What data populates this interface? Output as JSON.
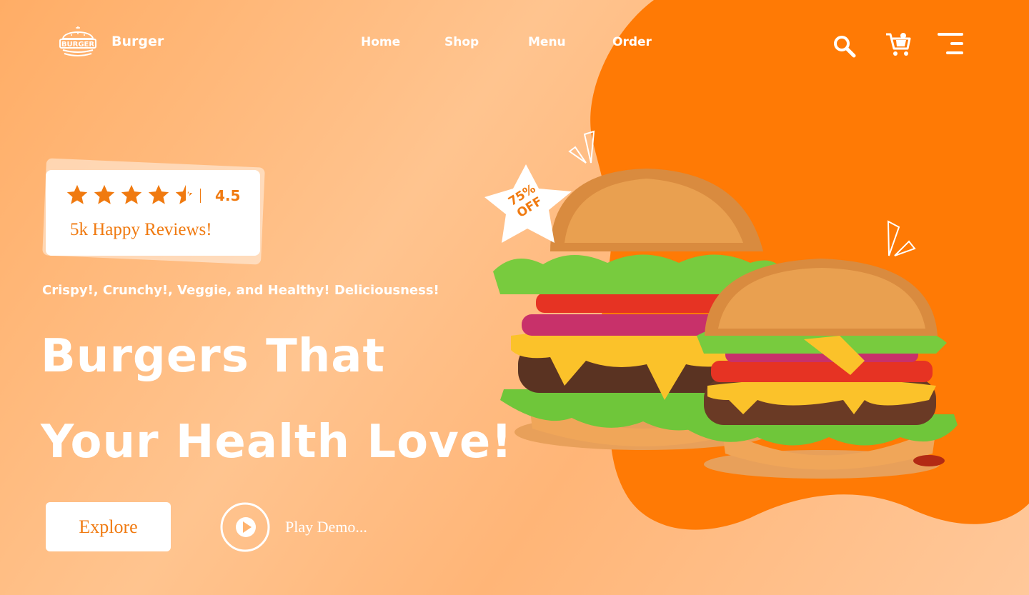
{
  "brand": {
    "name": "Burger",
    "logo_text": "BURGER",
    "logo_icon": "burger-logo-icon"
  },
  "nav": {
    "items": [
      {
        "label": "Home"
      },
      {
        "label": "Shop"
      },
      {
        "label": "Menu"
      },
      {
        "label": "Order"
      }
    ]
  },
  "header_icons": {
    "search": "search-icon",
    "cart": "cart-icon",
    "menu": "hamburger-menu-icon"
  },
  "rating": {
    "stars": 4.5,
    "value": "4.5",
    "reviews_label": "5k Happy Reviews!"
  },
  "hero": {
    "tagline": "Crispy!, Crunchy!, Veggie, and Healthy! Deliciousness!",
    "headline_line1": "Burgers That",
    "headline_line2": "Your Health Love!"
  },
  "actions": {
    "explore_label": "Explore",
    "play_label": "Play Demo..."
  },
  "promo": {
    "line1": "75%",
    "line2": "OFF"
  },
  "colors": {
    "accent": "#ff7a05",
    "background": "#ffbd85",
    "text_on_accent": "#ffffff",
    "brand_orange": "#f07a10"
  }
}
